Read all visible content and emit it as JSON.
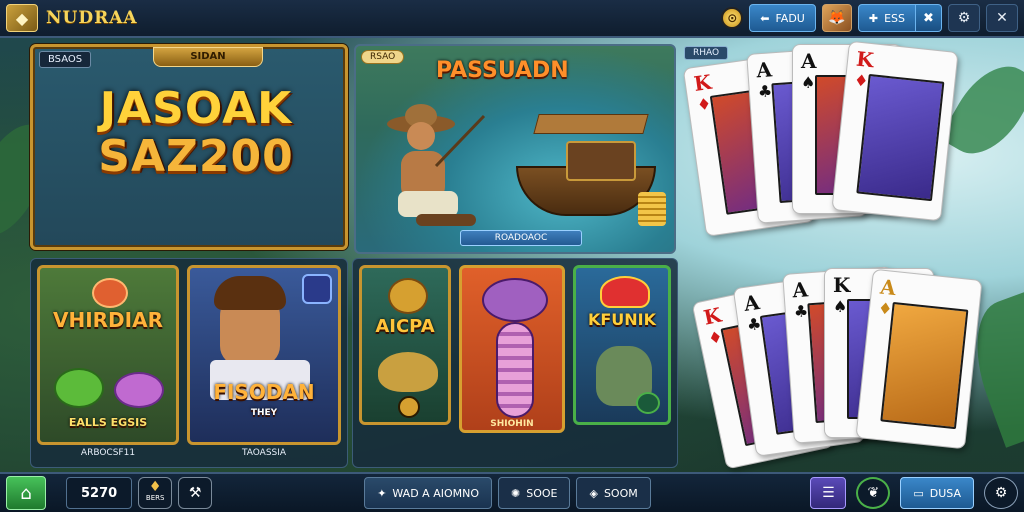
{
  "topbar": {
    "title": "NUDRAA",
    "coin_glyph": "⊙",
    "profile_btn_label": "FADU",
    "esc_btn_label": "ESS"
  },
  "featured": {
    "tag": "BSAOS",
    "plaque": "SIDAN",
    "title_line1": "JASOAK",
    "title_line2": "SAZ200"
  },
  "scene": {
    "tag": "RSAO",
    "title": "PASSUADN",
    "caption": "ROADOAOC"
  },
  "games_left": [
    {
      "name": "VHIRDIAR",
      "sub": "EALLS EGSIS",
      "label": "ARBOCSF11",
      "color": "#ffb23a"
    },
    {
      "name": "FISODAN",
      "sub": "THEY",
      "label": "TAOASSIA",
      "color": "#ffb23a"
    }
  ],
  "games_mid": [
    {
      "name": "AICPA",
      "label": "",
      "color": "#ffc43a"
    },
    {
      "name": "",
      "label": "SHIOHIN",
      "color": "#d9a0ff"
    },
    {
      "name": "KFUNIK",
      "label": "",
      "color": "#ffcf3a"
    }
  ],
  "cards_panel": {
    "tag": "RHAO"
  },
  "cards_top": [
    {
      "rank": "K",
      "suit": "♦",
      "color": "red"
    },
    {
      "rank": "A",
      "suit": "♣",
      "color": "black"
    },
    {
      "rank": "A",
      "suit": "♠",
      "color": "black"
    },
    {
      "rank": "K",
      "suit": "♦",
      "color": "red"
    }
  ],
  "cards_bottom": [
    {
      "rank": "K",
      "suit": "♦",
      "color": "red"
    },
    {
      "rank": "A",
      "suit": "♣",
      "color": "black"
    },
    {
      "rank": "A",
      "suit": "♣",
      "color": "black"
    },
    {
      "rank": "K",
      "suit": "♠",
      "color": "black"
    },
    {
      "rank": "A",
      "suit": "♦",
      "color": "gold"
    }
  ],
  "bottombar": {
    "balance": "5270",
    "coin_label": "BERS",
    "main_btn": "WAD A AIOMNO",
    "btn2": "SOOE",
    "btn3": "SOOM",
    "right_btn": "DUSA"
  },
  "colors": {
    "accent_gold": "#c8952f",
    "accent_blue": "#3a87c9",
    "home_green": "#47c25a"
  }
}
